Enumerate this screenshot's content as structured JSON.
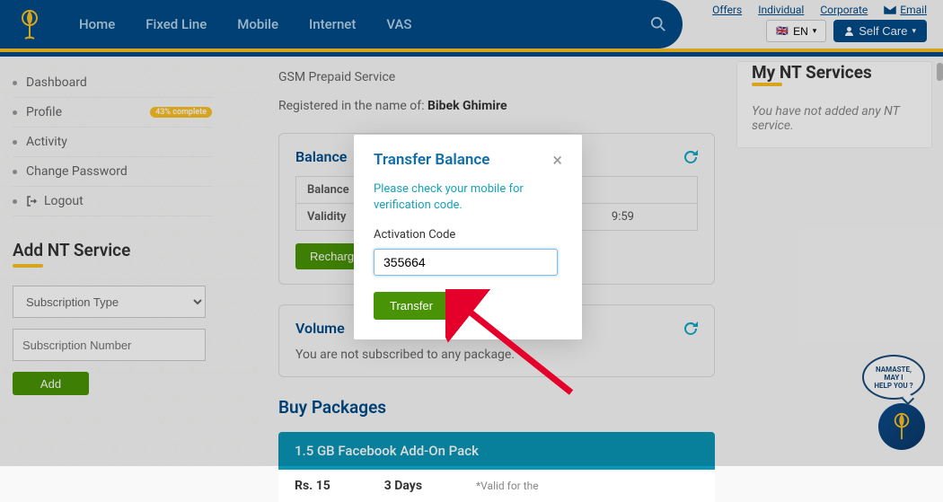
{
  "topbar": {
    "links": [
      "Offers",
      "Individual",
      "Corporate"
    ],
    "email_label": "Email",
    "lang": "EN",
    "selfcare": "Self Care"
  },
  "nav": {
    "items": [
      "Home",
      "Fixed Line",
      "Mobile",
      "Internet",
      "VAS"
    ]
  },
  "sidebar": {
    "items": [
      {
        "label": "Dashboard"
      },
      {
        "label": "Profile",
        "badge": "43% complete"
      },
      {
        "label": "Activity"
      },
      {
        "label": "Change Password"
      },
      {
        "label": "Logout",
        "icon": "logout"
      }
    ],
    "add_title": "Add NT Service",
    "subscription_type_placeholder": "Subscription Type",
    "subscription_number_placeholder": "Subscription Number",
    "add_btn": "Add"
  },
  "main": {
    "service_type": "GSM Prepaid Service",
    "registered_prefix": "Registered in the name of:",
    "registered_name": "Bibek Ghimire",
    "balance_card_title": "Balance",
    "balance_row_label": "Balance",
    "validity_row_label": "Validity",
    "validity_value_tail": "9:59",
    "recharge_btn": "Recharge",
    "volume_card_title": "Volume",
    "volume_msg": "You are not subscribed to any package.",
    "buy_title": "Buy Packages",
    "pack_name": "1.5 GB Facebook Add-On Pack",
    "pack_price": "Rs. 15",
    "pack_days": "3 Days",
    "pack_valid": "*Valid for the"
  },
  "rightcol": {
    "title": "My NT Services",
    "msg": "You have not added any NT service."
  },
  "modal": {
    "title": "Transfer Balance",
    "hint": "Please check your mobile for verification code.",
    "field_label": "Activation Code",
    "input_value": "355664",
    "transfer_btn": "Transfer"
  },
  "chat": {
    "l1": "NAMASTE,",
    "l2": "MAY I",
    "l3": "HELP YOU ?"
  }
}
